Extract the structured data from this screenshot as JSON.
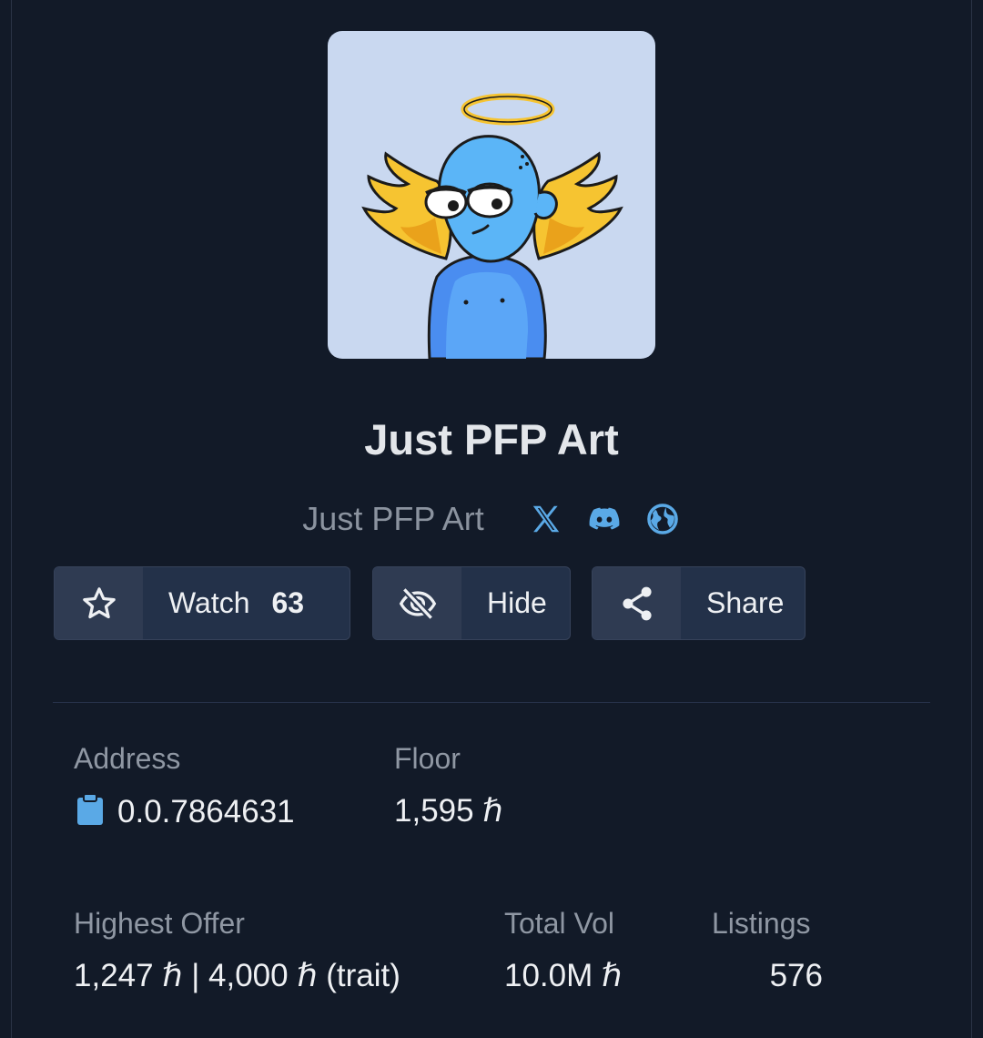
{
  "collection": {
    "title": "Just PFP Art",
    "creator": "Just PFP Art",
    "social_icons": [
      "x-twitter-icon",
      "discord-icon",
      "globe-icon"
    ]
  },
  "actions": {
    "watch": {
      "label": "Watch",
      "count": "63",
      "icon": "star-icon"
    },
    "hide": {
      "label": "Hide",
      "icon": "eye-off-icon"
    },
    "share": {
      "label": "Share",
      "icon": "share-icon"
    }
  },
  "stats": {
    "address": {
      "label": "Address",
      "value": "0.0.7864631",
      "icon": "clipboard-icon"
    },
    "floor": {
      "label": "Floor",
      "value": "1,595 ℏ"
    },
    "highest_offer": {
      "label": "Highest Offer",
      "value": "1,247 ℏ | 4,000 ℏ (trait)"
    },
    "total_vol": {
      "label": "Total Vol",
      "value": "10.0M ℏ"
    },
    "listings": {
      "label": "Listings",
      "value": "576"
    }
  },
  "colors": {
    "background": "#121a28",
    "button_bg": "#233149",
    "accent_icon": "#5aa9e6",
    "avatar_bg": "#c9d8f0"
  }
}
